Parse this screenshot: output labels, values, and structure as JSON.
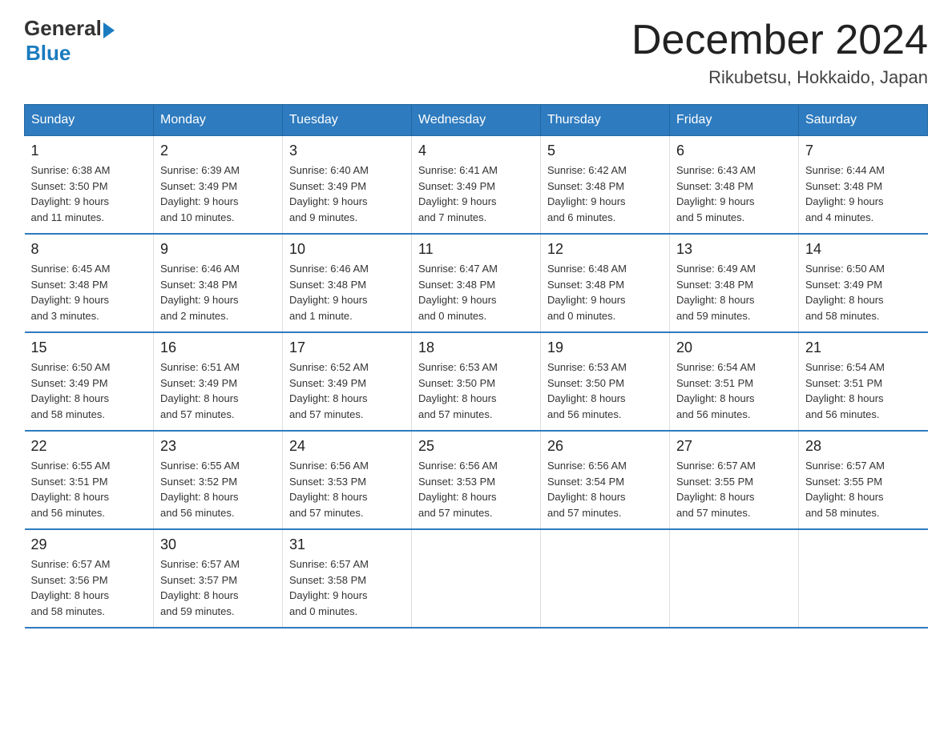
{
  "header": {
    "logo": {
      "general": "General",
      "blue": "Blue"
    },
    "title": "December 2024",
    "location": "Rikubetsu, Hokkaido, Japan"
  },
  "weekdays": [
    "Sunday",
    "Monday",
    "Tuesday",
    "Wednesday",
    "Thursday",
    "Friday",
    "Saturday"
  ],
  "weeks": [
    [
      {
        "day": "1",
        "info": "Sunrise: 6:38 AM\nSunset: 3:50 PM\nDaylight: 9 hours\nand 11 minutes."
      },
      {
        "day": "2",
        "info": "Sunrise: 6:39 AM\nSunset: 3:49 PM\nDaylight: 9 hours\nand 10 minutes."
      },
      {
        "day": "3",
        "info": "Sunrise: 6:40 AM\nSunset: 3:49 PM\nDaylight: 9 hours\nand 9 minutes."
      },
      {
        "day": "4",
        "info": "Sunrise: 6:41 AM\nSunset: 3:49 PM\nDaylight: 9 hours\nand 7 minutes."
      },
      {
        "day": "5",
        "info": "Sunrise: 6:42 AM\nSunset: 3:48 PM\nDaylight: 9 hours\nand 6 minutes."
      },
      {
        "day": "6",
        "info": "Sunrise: 6:43 AM\nSunset: 3:48 PM\nDaylight: 9 hours\nand 5 minutes."
      },
      {
        "day": "7",
        "info": "Sunrise: 6:44 AM\nSunset: 3:48 PM\nDaylight: 9 hours\nand 4 minutes."
      }
    ],
    [
      {
        "day": "8",
        "info": "Sunrise: 6:45 AM\nSunset: 3:48 PM\nDaylight: 9 hours\nand 3 minutes."
      },
      {
        "day": "9",
        "info": "Sunrise: 6:46 AM\nSunset: 3:48 PM\nDaylight: 9 hours\nand 2 minutes."
      },
      {
        "day": "10",
        "info": "Sunrise: 6:46 AM\nSunset: 3:48 PM\nDaylight: 9 hours\nand 1 minute."
      },
      {
        "day": "11",
        "info": "Sunrise: 6:47 AM\nSunset: 3:48 PM\nDaylight: 9 hours\nand 0 minutes."
      },
      {
        "day": "12",
        "info": "Sunrise: 6:48 AM\nSunset: 3:48 PM\nDaylight: 9 hours\nand 0 minutes."
      },
      {
        "day": "13",
        "info": "Sunrise: 6:49 AM\nSunset: 3:48 PM\nDaylight: 8 hours\nand 59 minutes."
      },
      {
        "day": "14",
        "info": "Sunrise: 6:50 AM\nSunset: 3:49 PM\nDaylight: 8 hours\nand 58 minutes."
      }
    ],
    [
      {
        "day": "15",
        "info": "Sunrise: 6:50 AM\nSunset: 3:49 PM\nDaylight: 8 hours\nand 58 minutes."
      },
      {
        "day": "16",
        "info": "Sunrise: 6:51 AM\nSunset: 3:49 PM\nDaylight: 8 hours\nand 57 minutes."
      },
      {
        "day": "17",
        "info": "Sunrise: 6:52 AM\nSunset: 3:49 PM\nDaylight: 8 hours\nand 57 minutes."
      },
      {
        "day": "18",
        "info": "Sunrise: 6:53 AM\nSunset: 3:50 PM\nDaylight: 8 hours\nand 57 minutes."
      },
      {
        "day": "19",
        "info": "Sunrise: 6:53 AM\nSunset: 3:50 PM\nDaylight: 8 hours\nand 56 minutes."
      },
      {
        "day": "20",
        "info": "Sunrise: 6:54 AM\nSunset: 3:51 PM\nDaylight: 8 hours\nand 56 minutes."
      },
      {
        "day": "21",
        "info": "Sunrise: 6:54 AM\nSunset: 3:51 PM\nDaylight: 8 hours\nand 56 minutes."
      }
    ],
    [
      {
        "day": "22",
        "info": "Sunrise: 6:55 AM\nSunset: 3:51 PM\nDaylight: 8 hours\nand 56 minutes."
      },
      {
        "day": "23",
        "info": "Sunrise: 6:55 AM\nSunset: 3:52 PM\nDaylight: 8 hours\nand 56 minutes."
      },
      {
        "day": "24",
        "info": "Sunrise: 6:56 AM\nSunset: 3:53 PM\nDaylight: 8 hours\nand 57 minutes."
      },
      {
        "day": "25",
        "info": "Sunrise: 6:56 AM\nSunset: 3:53 PM\nDaylight: 8 hours\nand 57 minutes."
      },
      {
        "day": "26",
        "info": "Sunrise: 6:56 AM\nSunset: 3:54 PM\nDaylight: 8 hours\nand 57 minutes."
      },
      {
        "day": "27",
        "info": "Sunrise: 6:57 AM\nSunset: 3:55 PM\nDaylight: 8 hours\nand 57 minutes."
      },
      {
        "day": "28",
        "info": "Sunrise: 6:57 AM\nSunset: 3:55 PM\nDaylight: 8 hours\nand 58 minutes."
      }
    ],
    [
      {
        "day": "29",
        "info": "Sunrise: 6:57 AM\nSunset: 3:56 PM\nDaylight: 8 hours\nand 58 minutes."
      },
      {
        "day": "30",
        "info": "Sunrise: 6:57 AM\nSunset: 3:57 PM\nDaylight: 8 hours\nand 59 minutes."
      },
      {
        "day": "31",
        "info": "Sunrise: 6:57 AM\nSunset: 3:58 PM\nDaylight: 9 hours\nand 0 minutes."
      },
      {
        "day": "",
        "info": ""
      },
      {
        "day": "",
        "info": ""
      },
      {
        "day": "",
        "info": ""
      },
      {
        "day": "",
        "info": ""
      }
    ]
  ]
}
